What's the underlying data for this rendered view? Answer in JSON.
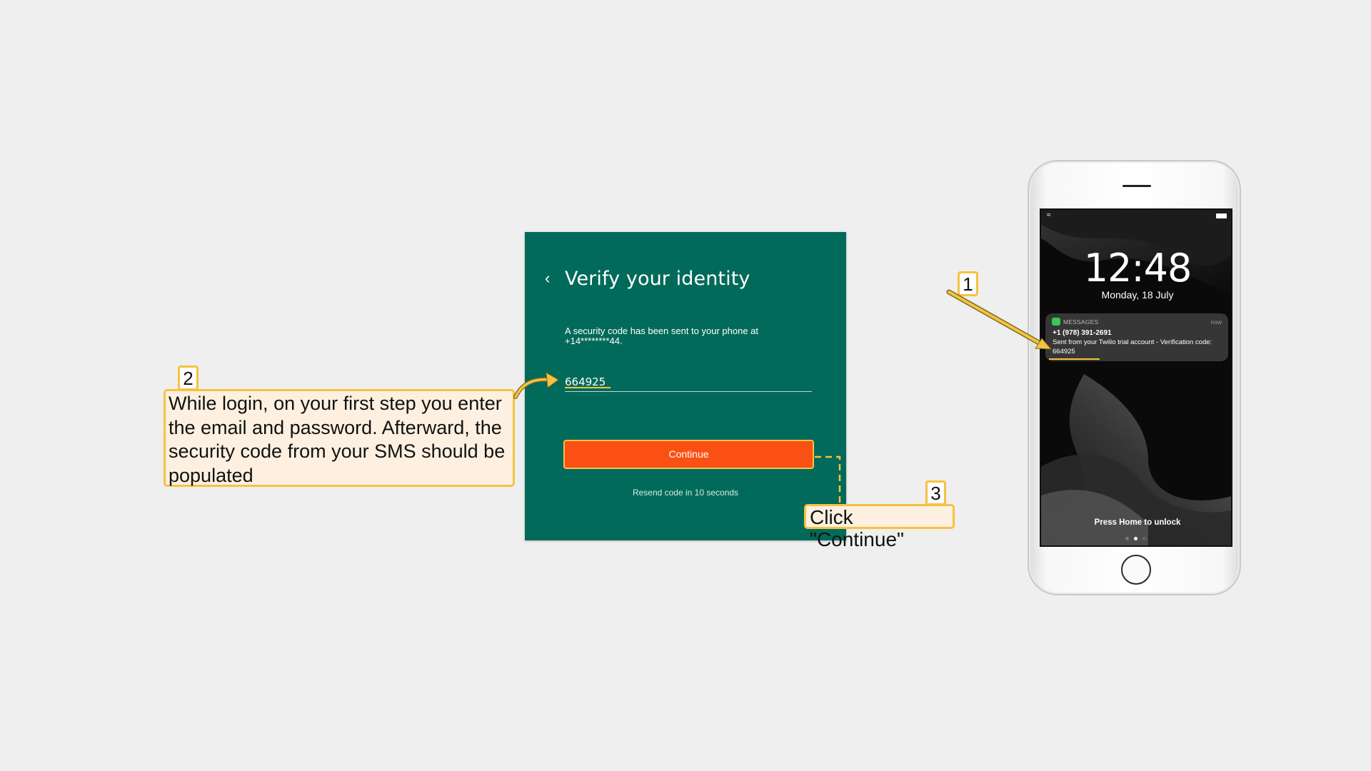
{
  "verify": {
    "back_icon": "chevron-left-icon",
    "title": "Verify your identity",
    "description": "A security code has been sent to your phone at +14********44.",
    "code_value": "664925",
    "continue_label": "Continue",
    "resend_text": "Resend code in 10 seconds",
    "colors": {
      "card_bg": "#026a5a",
      "button_bg": "#fa5014",
      "highlight": "#f5c242"
    }
  },
  "callouts": {
    "step1_number": "1",
    "step2_number": "2",
    "step2_text": "While login, on your first step you enter the email and password. Afterward, the security code from your SMS should be populated",
    "step3_number": "3",
    "step3_text": "Click \"Continue\""
  },
  "phone": {
    "status_icons": [
      "wifi-icon",
      "battery-icon"
    ],
    "time": "12:48",
    "date": "Monday, 18 July",
    "notification": {
      "app_icon": "messages-icon",
      "app": "MESSAGES",
      "time": "now",
      "sender": "+1 (978) 391-2691",
      "body": "Sent from your Twilio trial account - Verification code: 664925"
    },
    "unlock_hint": "Press Home to unlock"
  }
}
